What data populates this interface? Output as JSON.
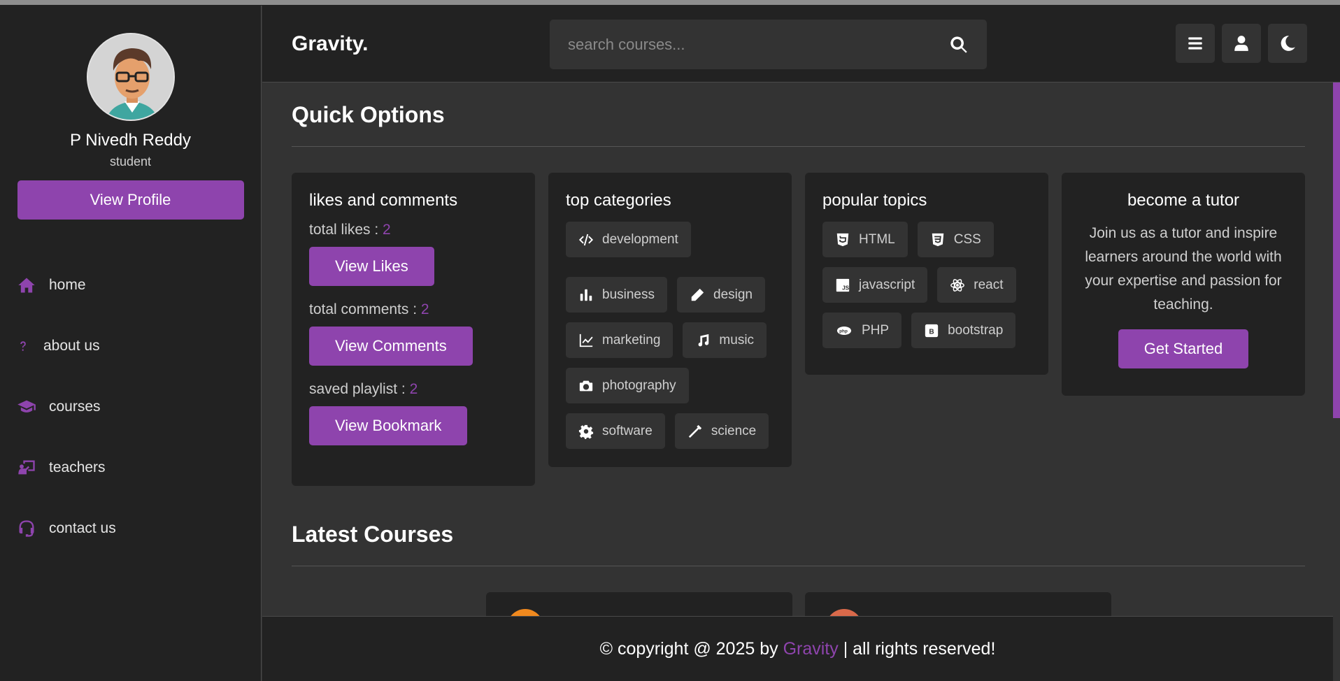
{
  "app": {
    "logo": "Gravity."
  },
  "profile": {
    "name": "P Nivedh Reddy",
    "role": "student",
    "button": "View Profile"
  },
  "nav": [
    {
      "label": "home",
      "icon": "home-icon"
    },
    {
      "label": "about us",
      "icon": "question-icon"
    },
    {
      "label": "courses",
      "icon": "graduation-cap-icon"
    },
    {
      "label": "teachers",
      "icon": "chalkboard-teacher-icon"
    },
    {
      "label": "contact us",
      "icon": "headset-icon"
    }
  ],
  "search": {
    "placeholder": "search courses..."
  },
  "header_icons": [
    "menu-icon",
    "user-icon",
    "moon-icon"
  ],
  "quick": {
    "title": "Quick Options",
    "likes": {
      "title": "likes and comments",
      "likes_label": "total likes : ",
      "likes_value": "2",
      "likes_button": "View Likes",
      "comments_label": "total comments : ",
      "comments_value": "2",
      "comments_button": "View Comments",
      "playlist_label": "saved playlist : ",
      "playlist_value": "2",
      "playlist_button": "View Bookmark"
    },
    "categories": {
      "title": "top categories",
      "items": [
        "development",
        "business",
        "design",
        "marketing",
        "music",
        "photography",
        "software",
        "science"
      ]
    },
    "topics": {
      "title": "popular topics",
      "items": [
        "HTML",
        "CSS",
        "javascript",
        "react",
        "PHP",
        "bootstrap"
      ]
    },
    "tutor": {
      "title": "become a tutor",
      "text": "Join us as a tutor and inspire learners around the world with your expertise and passion for teaching.",
      "button": "Get Started"
    }
  },
  "latest": {
    "title": "Latest Courses"
  },
  "footer": {
    "prefix": "© copyright @ 2025 by ",
    "brand": "Gravity",
    "suffix": " | all rights reserved!"
  },
  "colors": {
    "accent": "#8e44ad",
    "panel": "#222222",
    "background": "#333333"
  }
}
